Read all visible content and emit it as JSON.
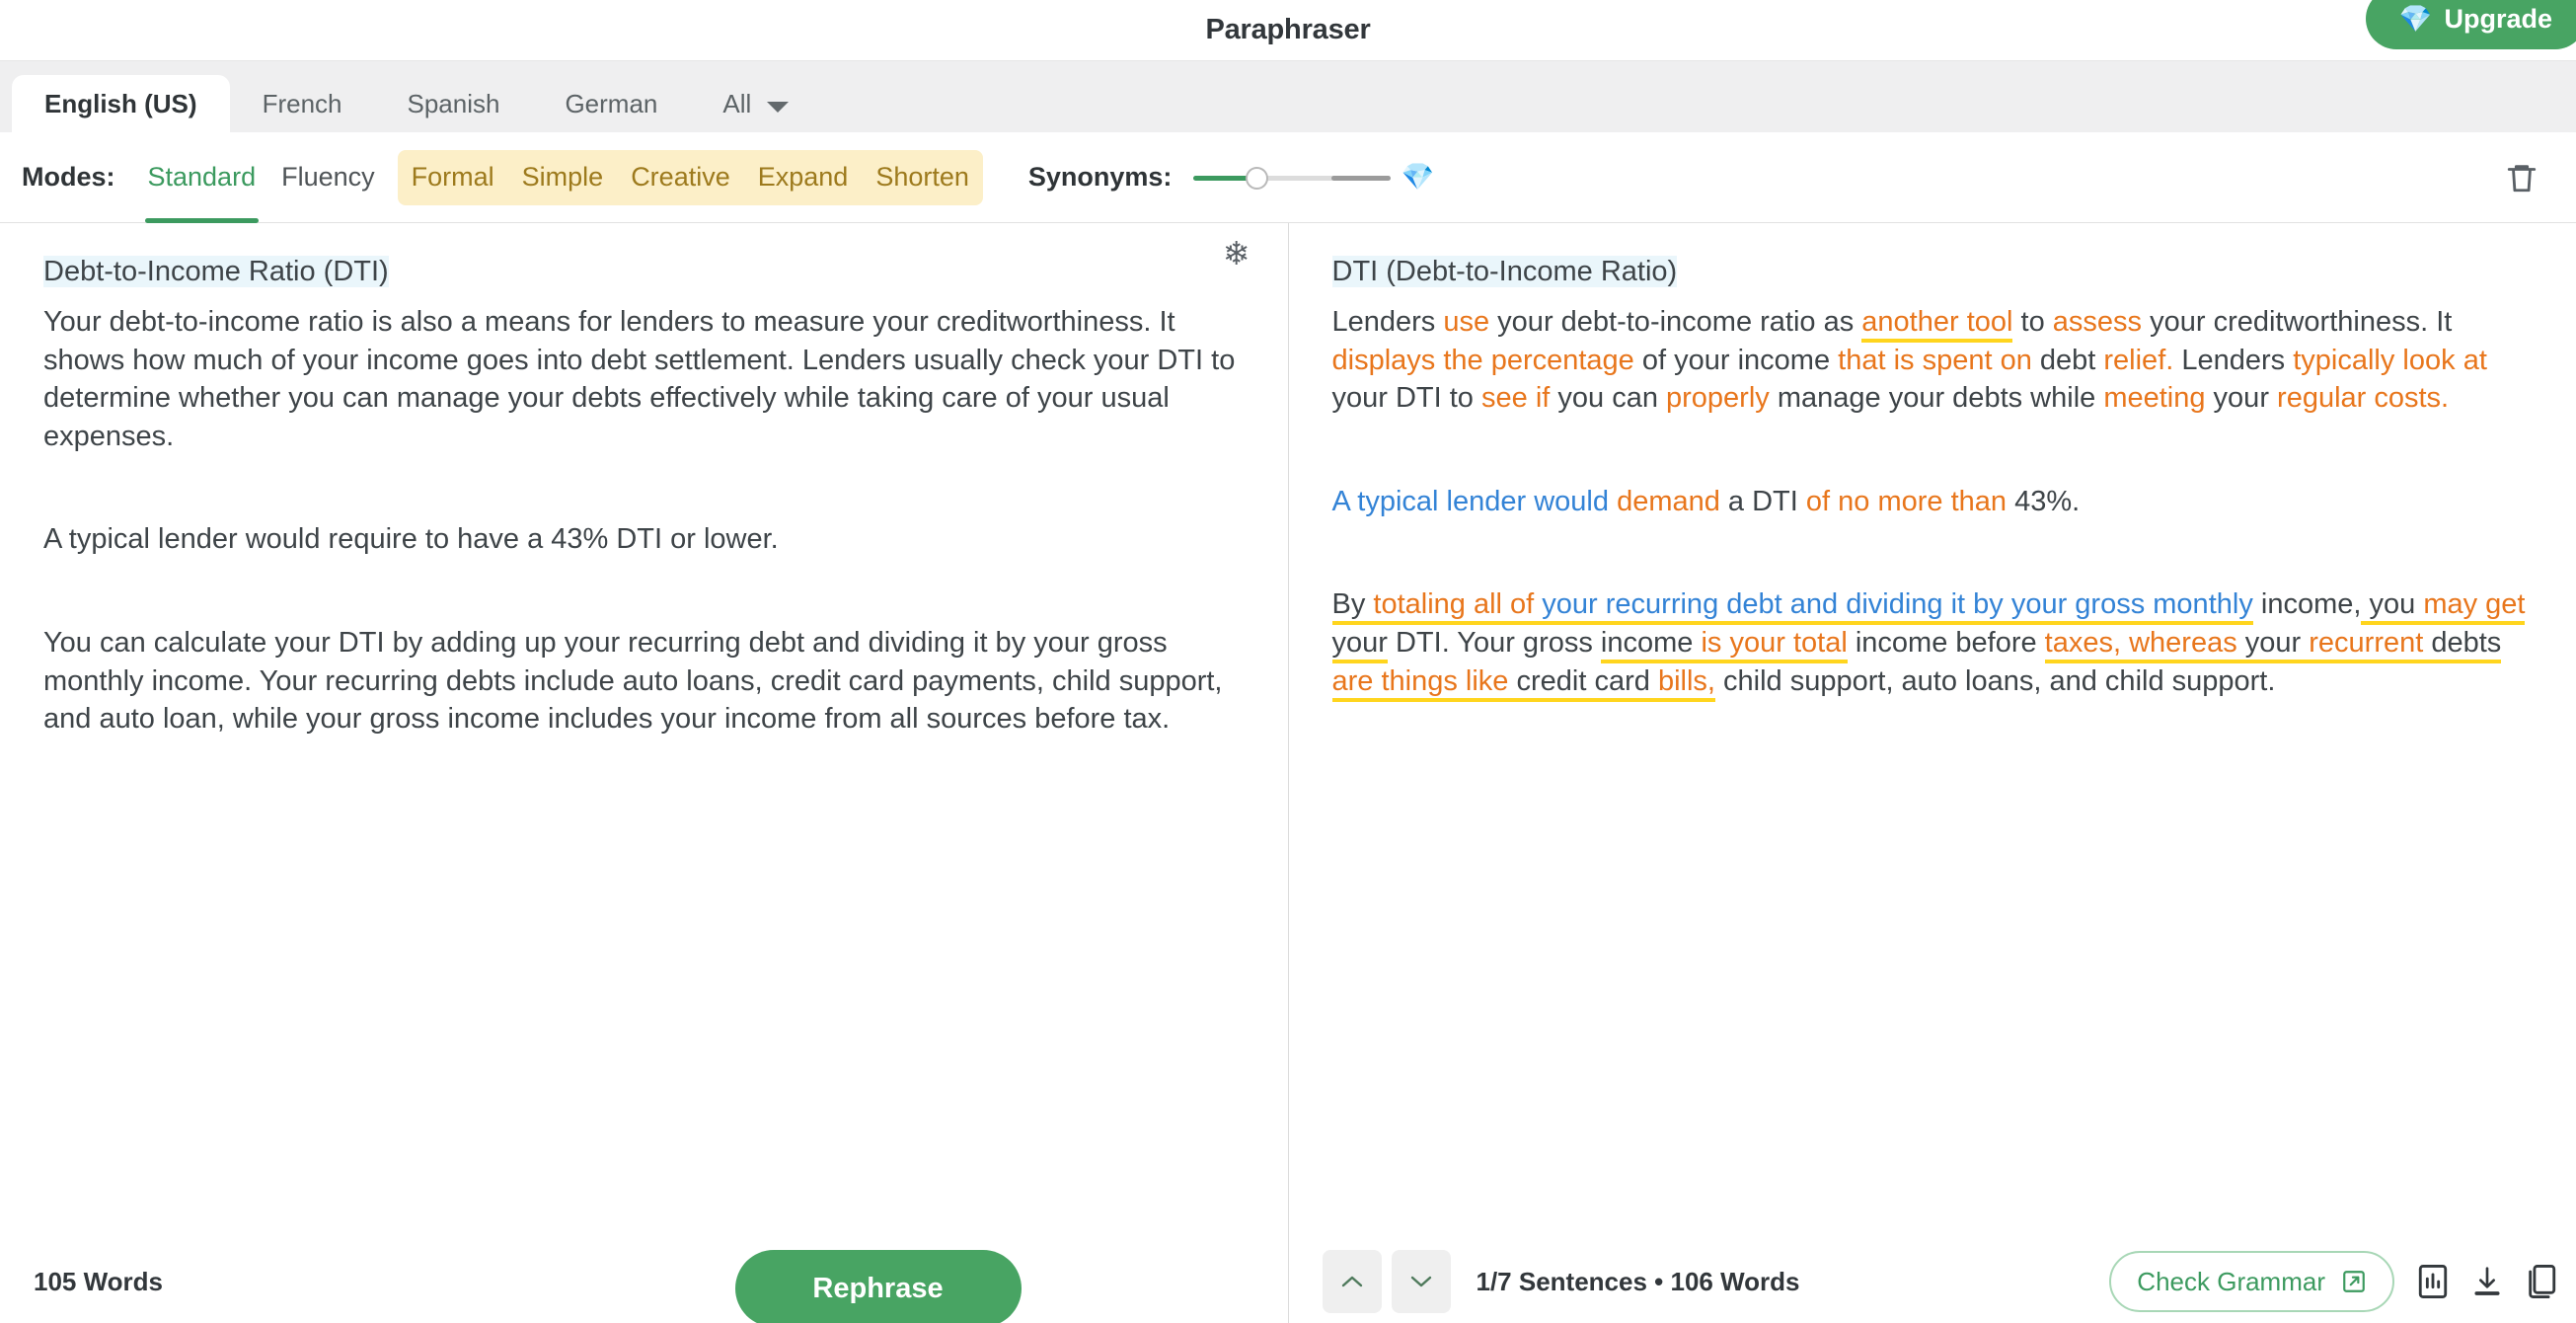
{
  "header": {
    "title": "Paraphraser",
    "upgrade_label": "Upgrade",
    "upgrade_icon": "gem-icon",
    "accent_green": "#48a463"
  },
  "language_tabs": {
    "items": [
      {
        "label": "English (US)",
        "active": true
      },
      {
        "label": "French",
        "active": false
      },
      {
        "label": "Spanish",
        "active": false
      },
      {
        "label": "German",
        "active": false
      },
      {
        "label": "All",
        "active": false,
        "icon": "chevron-down-icon"
      }
    ]
  },
  "modes": {
    "label": "Modes:",
    "free_items": [
      {
        "label": "Standard",
        "active": true
      },
      {
        "label": "Fluency",
        "active": false
      }
    ],
    "premium_items": [
      {
        "label": "Formal"
      },
      {
        "label": "Simple"
      },
      {
        "label": "Creative"
      },
      {
        "label": "Expand"
      },
      {
        "label": "Shorten"
      }
    ],
    "premium_bg": "#fcefc8",
    "active_color": "#3c9a5f",
    "premium_color": "#9d7a1d"
  },
  "synonyms": {
    "label": "Synonyms:",
    "value_percent": 30,
    "gem_icon": "gem-icon",
    "fill_color": "#3c9a5f"
  },
  "toolbar": {
    "delete_icon": "trash-icon"
  },
  "left_pane": {
    "freeze_icon": "snowflake-icon",
    "title": "Debt-to-Income Ratio (DTI)",
    "paragraphs": [
      "Your debt-to-income ratio is also a means for lenders to measure your creditworthiness. It shows how much of your income goes into debt settlement. Lenders usually check your DTI to determine whether you can manage your debts effectively while taking care of your usual expenses.",
      "A typical lender would require to have a 43% DTI or lower.",
      "You can calculate your DTI by adding up your recurring debt and dividing it by your gross monthly income. Your recurring debts include auto loans, credit card payments, child support, and auto loan, while your gross income includes your income from all sources before tax."
    ],
    "word_count": "105 Words",
    "rephrase_label": "Rephrase"
  },
  "right_pane": {
    "title": "DTI (Debt-to-Income Ratio)",
    "paragraph1": {
      "segments": [
        {
          "t": "Lenders ",
          "c": "plain"
        },
        {
          "t": "use",
          "c": "orange"
        },
        {
          "t": " your debt-to-income ratio as ",
          "c": "plain"
        },
        {
          "t": "another tool",
          "c": "orange-underline"
        },
        {
          "t": " to ",
          "c": "plain"
        },
        {
          "t": "assess",
          "c": "orange"
        },
        {
          "t": " your creditworthiness. It ",
          "c": "plain"
        },
        {
          "t": "displays the percentage",
          "c": "orange"
        },
        {
          "t": " of your income ",
          "c": "plain"
        },
        {
          "t": "that is spent on",
          "c": "orange"
        },
        {
          "t": " debt ",
          "c": "plain"
        },
        {
          "t": "relief.",
          "c": "orange"
        },
        {
          "t": " Lenders ",
          "c": "plain"
        },
        {
          "t": "typically look at",
          "c": "orange"
        },
        {
          "t": " your DTI to ",
          "c": "plain"
        },
        {
          "t": "see if",
          "c": "orange"
        },
        {
          "t": " you can ",
          "c": "plain"
        },
        {
          "t": "properly",
          "c": "orange"
        },
        {
          "t": " manage your debts while ",
          "c": "plain"
        },
        {
          "t": "meeting",
          "c": "orange"
        },
        {
          "t": " your ",
          "c": "plain"
        },
        {
          "t": "regular costs.",
          "c": "orange"
        }
      ]
    },
    "paragraph2": {
      "segments": [
        {
          "t": "A typical lender would ",
          "c": "blue"
        },
        {
          "t": "demand",
          "c": "orange"
        },
        {
          "t": " a DTI ",
          "c": "plain"
        },
        {
          "t": "of no more than",
          "c": "orange"
        },
        {
          "t": " 43%.",
          "c": "plain"
        }
      ]
    },
    "paragraph3": {
      "segments": [
        {
          "t": "By ",
          "c": "plain-underline"
        },
        {
          "t": "totaling all of",
          "c": "orange-underline"
        },
        {
          "t": " your recurring debt and dividing it by your gross monthly",
          "c": "blue-underline"
        },
        {
          "t": " income,",
          "c": "plain"
        },
        {
          "t": " you ",
          "c": "plain-underline"
        },
        {
          "t": "may get",
          "c": "orange-underline"
        },
        {
          "t": " your",
          "c": "plain-underline"
        },
        {
          "t": " DTI. Your gross ",
          "c": "plain"
        },
        {
          "t": "income ",
          "c": "plain-underline"
        },
        {
          "t": "is your",
          "c": "orange-underline"
        },
        {
          "t": " ",
          "c": "plain-underline"
        },
        {
          "t": "total",
          "c": "orange-underline"
        },
        {
          "t": " income before ",
          "c": "plain"
        },
        {
          "t": "taxes, whereas",
          "c": "orange-underline"
        },
        {
          "t": " your ",
          "c": "plain-underline"
        },
        {
          "t": "recurrent",
          "c": "orange-underline"
        },
        {
          "t": " debts ",
          "c": "plain-underline"
        },
        {
          "t": "are things like",
          "c": "orange-underline"
        },
        {
          "t": " credit card ",
          "c": "plain-underline"
        },
        {
          "t": "bills,",
          "c": "orange-underline"
        },
        {
          "t": " child support, auto loans, and child support.",
          "c": "plain"
        }
      ]
    },
    "nav_up_icon": "chevron-up-icon",
    "nav_down_icon": "chevron-down-icon",
    "status": "1/7 Sentences • 106 Words",
    "check_grammar_label": "Check Grammar",
    "check_grammar_icon": "external-link-icon",
    "stats_icon": "bar-chart-icon",
    "download_icon": "download-icon",
    "copy_icon": "copy-icon"
  },
  "colors": {
    "orange": "#e8761c",
    "blue": "#3383d6",
    "underline_yellow": "#ffd51e",
    "title_highlight": "#eaf6fb"
  }
}
